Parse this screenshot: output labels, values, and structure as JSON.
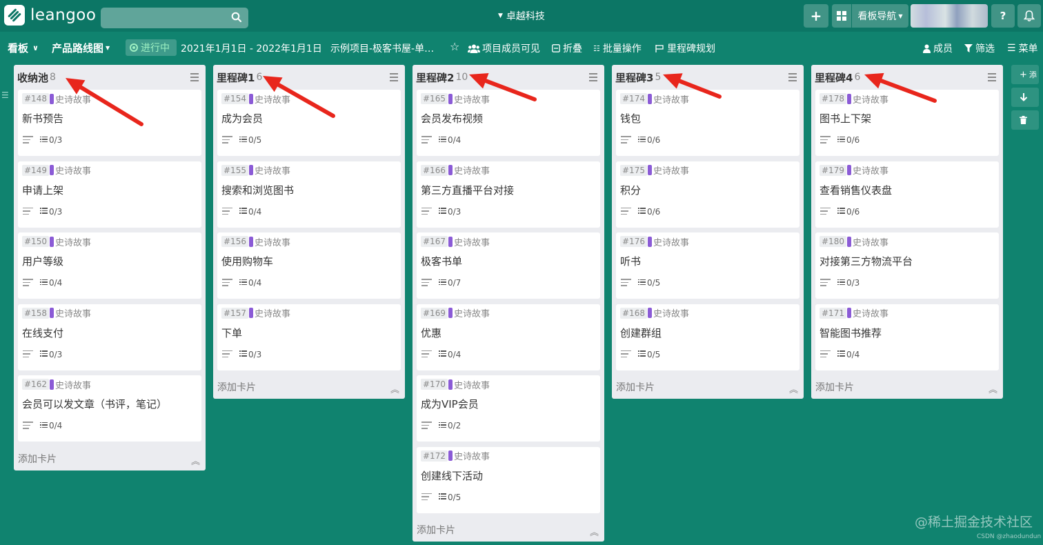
{
  "app": {
    "logo_text": "leangoo",
    "company": "卓越科技",
    "nav_label": "看板导航",
    "add_symbol": "+",
    "help_symbol": "?"
  },
  "board": {
    "view_label": "看板",
    "name": "产品路线图",
    "status": "进行中",
    "date_range": "2021年1月1日 - 2022年1月1日",
    "project": "示例项目-极客书屋-单…",
    "visibility": "项目成员可见",
    "fold": "折叠",
    "batch": "批量操作",
    "milestone_plan": "里程碑规划",
    "members": "成员",
    "filter": "筛选",
    "menu": "菜单"
  },
  "card_label_text": "史诗故事",
  "columns": [
    {
      "title": "收纳池",
      "count": "8",
      "add": "添加卡片",
      "cards": [
        {
          "id": "#148",
          "label": "史诗故事",
          "title": "新书预告",
          "checklist": "0/3"
        },
        {
          "id": "#149",
          "label": "史诗故事",
          "title": "申请上架",
          "checklist": "0/3"
        },
        {
          "id": "#150",
          "label": "史诗故事",
          "title": "用户等级",
          "checklist": "0/4"
        },
        {
          "id": "#158",
          "label": "史诗故事",
          "title": "在线支付",
          "checklist": "0/3"
        },
        {
          "id": "#162",
          "label": "史诗故事",
          "title": "会员可以发文章（书评，笔记）",
          "checklist": "0/4"
        }
      ]
    },
    {
      "title": "里程碑1",
      "count": "6",
      "add": "添加卡片",
      "cards": [
        {
          "id": "#154",
          "label": "史诗故事",
          "title": "成为会员",
          "checklist": "0/5"
        },
        {
          "id": "#155",
          "label": "史诗故事",
          "title": "搜索和浏览图书",
          "checklist": "0/4"
        },
        {
          "id": "#156",
          "label": "史诗故事",
          "title": "使用购物车",
          "checklist": "0/4"
        },
        {
          "id": "#157",
          "label": "史诗故事",
          "title": "下单",
          "checklist": "0/3"
        }
      ]
    },
    {
      "title": "里程碑2",
      "count": "10",
      "add": "添加卡片",
      "cards": [
        {
          "id": "#165",
          "label": "史诗故事",
          "title": "会员发布视频",
          "checklist": "0/4"
        },
        {
          "id": "#166",
          "label": "史诗故事",
          "title": "第三方直播平台对接",
          "checklist": "0/3"
        },
        {
          "id": "#167",
          "label": "史诗故事",
          "title": "极客书单",
          "checklist": "0/7"
        },
        {
          "id": "#169",
          "label": "史诗故事",
          "title": "优惠",
          "checklist": "0/4"
        },
        {
          "id": "#170",
          "label": "史诗故事",
          "title": "成为VIP会员",
          "checklist": "0/2"
        },
        {
          "id": "#172",
          "label": "史诗故事",
          "title": "创建线下活动",
          "checklist": "0/5"
        }
      ]
    },
    {
      "title": "里程碑3",
      "count": "5",
      "add": "添加卡片",
      "cards": [
        {
          "id": "#174",
          "label": "史诗故事",
          "title": "钱包",
          "checklist": "0/6"
        },
        {
          "id": "#175",
          "label": "史诗故事",
          "title": "积分",
          "checklist": "0/6"
        },
        {
          "id": "#176",
          "label": "史诗故事",
          "title": "听书",
          "checklist": "0/5"
        },
        {
          "id": "#168",
          "label": "史诗故事",
          "title": "创建群组",
          "checklist": "0/5"
        }
      ]
    },
    {
      "title": "里程碑4",
      "count": "6",
      "add": "添加卡片",
      "cards": [
        {
          "id": "#178",
          "label": "史诗故事",
          "title": "图书上下架",
          "checklist": "0/6"
        },
        {
          "id": "#179",
          "label": "史诗故事",
          "title": "查看销售仪表盘",
          "checklist": "0/6"
        },
        {
          "id": "#180",
          "label": "史诗故事",
          "title": "对接第三方物流平台",
          "checklist": "0/3"
        },
        {
          "id": "#171",
          "label": "史诗故事",
          "title": "智能图书推荐",
          "checklist": "0/4"
        }
      ]
    }
  ],
  "right_tools": {
    "add_list": "添"
  },
  "watermark": "@稀土掘金技术社区",
  "credit": "CSDN @zhaodundun",
  "colors": {
    "background": "#10836f",
    "topbar": "#0c7665",
    "label": "#8b5bd6",
    "annotation_arrow": "#e8261c"
  }
}
